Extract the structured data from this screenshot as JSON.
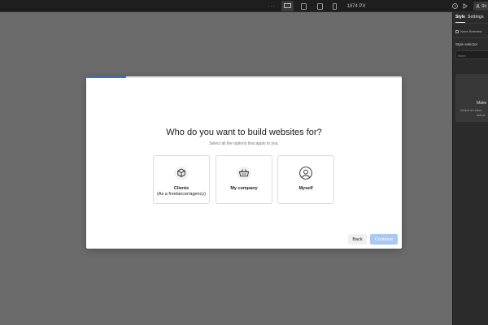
{
  "topbar": {
    "more_label": "···",
    "width_label": "1874 PX",
    "share_label": "Sh"
  },
  "panel": {
    "tabs": [
      {
        "label": "Style",
        "active": true
      },
      {
        "label": "Settings",
        "active": false
      }
    ],
    "none_selected": "None Selected",
    "style_selector_label": "Style selector",
    "style_selector_placeholder": "None",
    "card_title": "Make",
    "card_text_1": "Select an elem",
    "card_text_2": "activa"
  },
  "modal": {
    "progress": 0.125,
    "title": "Who do you want to build websites for?",
    "subtitle": "Select all the options that apply to you.",
    "options": [
      {
        "label": "Clients",
        "description": "(As a freelancer/agency)",
        "icon": "cube-icon"
      },
      {
        "label": "My company",
        "description": "",
        "icon": "basket-icon"
      },
      {
        "label": "Myself",
        "description": "",
        "icon": "user-icon"
      }
    ],
    "back_label": "Back",
    "continue_label": "Continue"
  },
  "colors": {
    "canvas": "#6b6b6b",
    "topbar": "#1e1e1e",
    "panel": "#2b2b2b",
    "accent": "#2f6fe4",
    "continue_disabled": "#a9c8f5"
  }
}
